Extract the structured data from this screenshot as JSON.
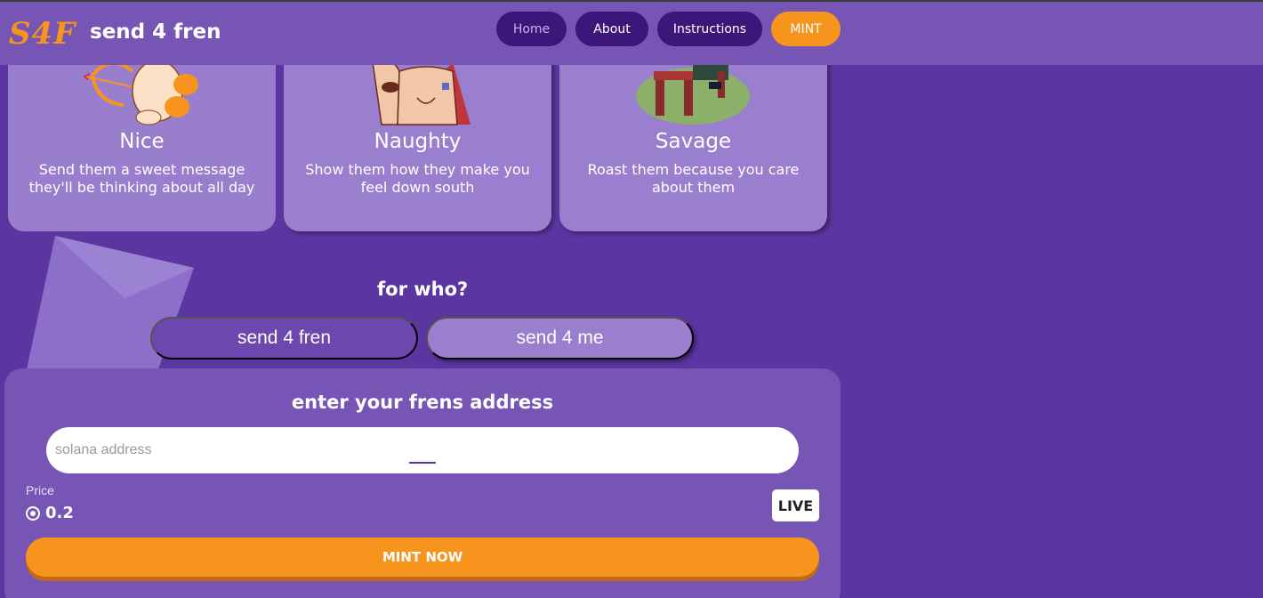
{
  "navbar": {
    "logo_text": "S4F",
    "site_title": "send 4 fren",
    "links": [
      {
        "label": "Home",
        "active": true
      },
      {
        "label": "About"
      },
      {
        "label": "Instructions"
      },
      {
        "label": "MINT"
      }
    ]
  },
  "cards": [
    {
      "title": "Nice",
      "description": "Send them a sweet message they'll be thinking about all day",
      "art": "cupid-bear-illustration"
    },
    {
      "title": "Naughty",
      "description": "Show them how they make you feel down south",
      "art": "character-illustration"
    },
    {
      "title": "Savage",
      "description": "Roast them because you care about them",
      "art": "bench-on-grass-illustration"
    }
  ],
  "recipient": {
    "heading": "for who?",
    "options": [
      {
        "label": "send 4 fren",
        "selected": true
      },
      {
        "label": "send 4 me",
        "selected": false
      }
    ]
  },
  "mint_panel": {
    "heading": "enter your frens address",
    "address_placeholder": "solana address",
    "address_value": "",
    "price_label": "Price",
    "price_value": "0.2",
    "price_icon": "solana-icon",
    "status_badge": "LIVE",
    "mint_button": "MINT NOW"
  },
  "colors": {
    "background": "#5b36a0",
    "navbar": "#7755b5",
    "card": "#9b7fcf",
    "accent_orange": "#f7941d",
    "nav_button": "#3a1778"
  }
}
